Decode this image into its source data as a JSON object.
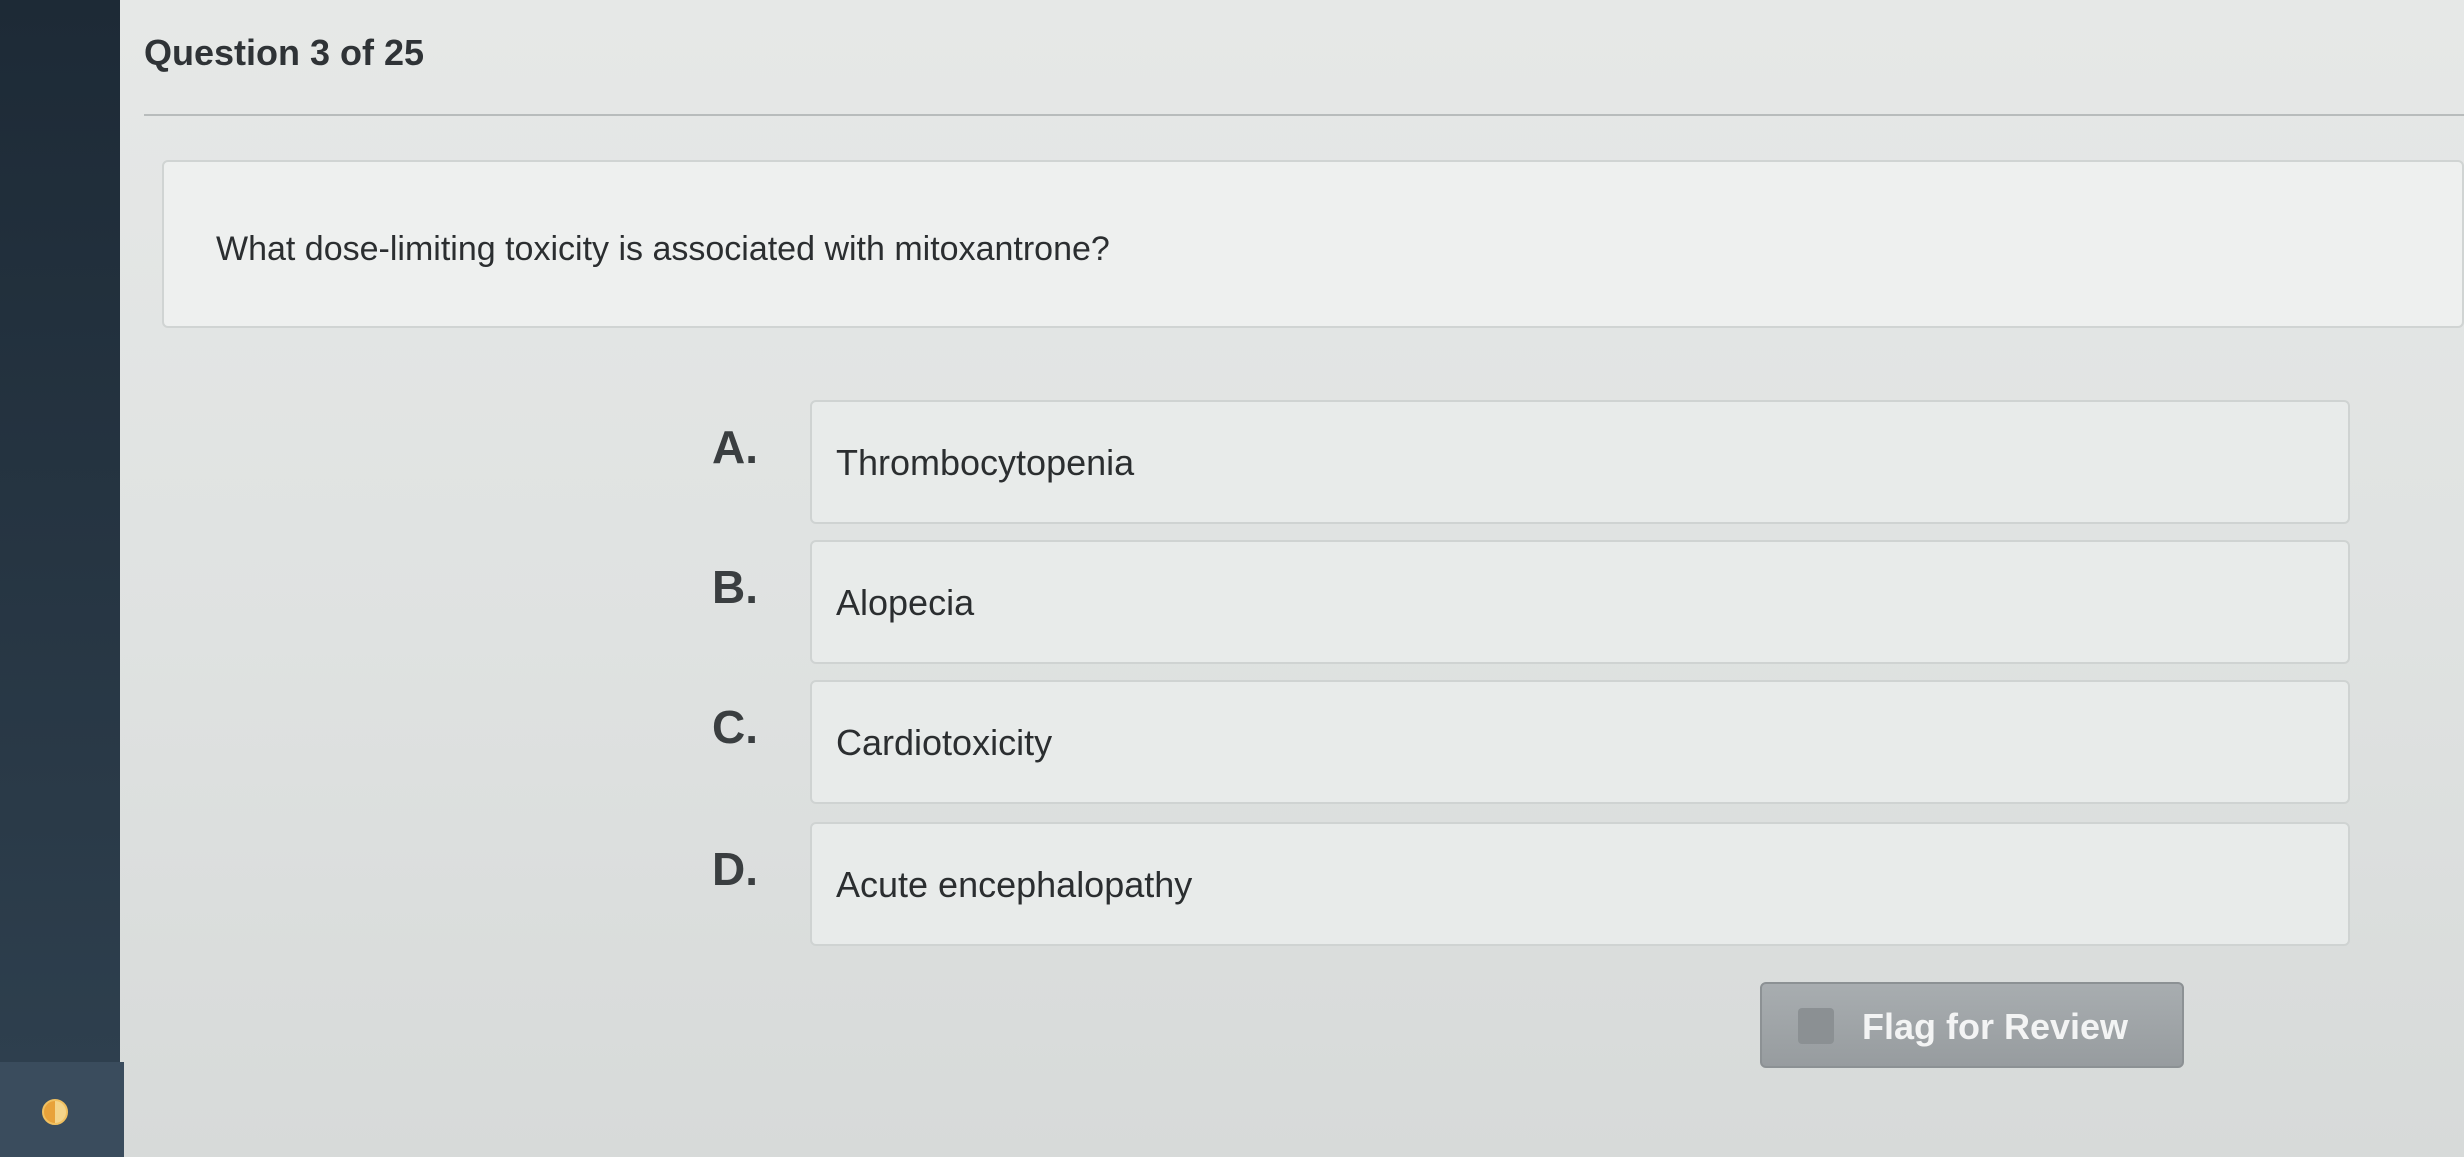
{
  "header": {
    "counter": "Question 3 of 25"
  },
  "question": {
    "text": "What dose-limiting toxicity is associated with mitoxantrone?"
  },
  "options": [
    {
      "letter": "A.",
      "text": "Thrombocytopenia"
    },
    {
      "letter": "B.",
      "text": "Alopecia"
    },
    {
      "letter": "C.",
      "text": "Cardiotoxicity"
    },
    {
      "letter": "D.",
      "text": "Acute encephalopathy"
    }
  ],
  "flag": {
    "label": "Flag for Review"
  },
  "sidebar": {
    "icon": "progress-icon"
  },
  "colors": {
    "sidebar": "#1d2a36",
    "flag_button": "#a8adb0",
    "progress_icon": "#e8a23a"
  }
}
